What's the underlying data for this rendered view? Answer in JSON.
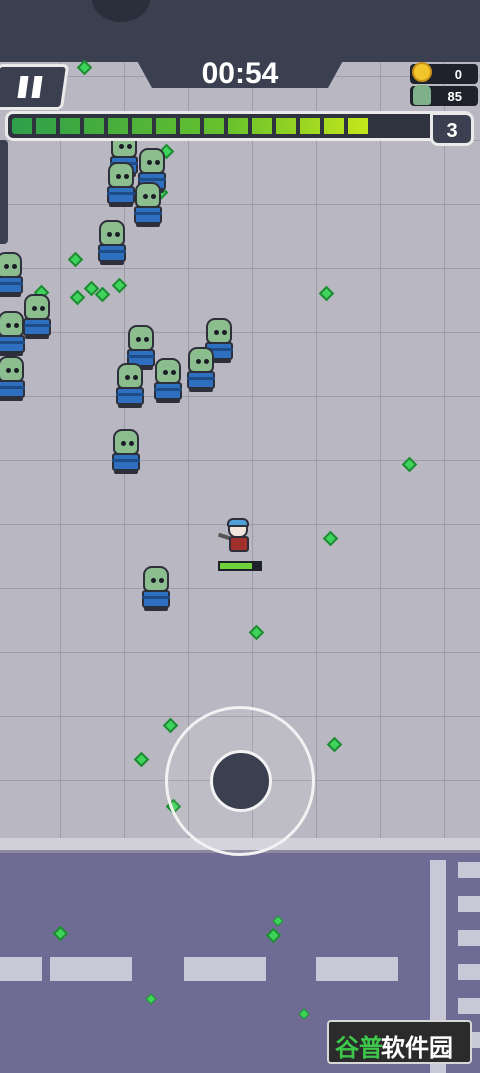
{
  "hud": {
    "timer": "00:54",
    "coins": "0",
    "kills": "85",
    "level": "3",
    "xp_progress": 0.87,
    "icons": {
      "pause": "pause-icon",
      "coin": "coin-icon",
      "kill": "zombie-kill-icon"
    }
  },
  "player": {
    "health": 0.8
  },
  "watermark": {
    "part1": "谷普",
    "part2": "软件园"
  },
  "colors": {
    "floor": "#b9b7c1",
    "road": "#6e6b95",
    "hud": "#3b4050",
    "gem": "#3ed35a",
    "xp_end": "#c7e81a"
  }
}
